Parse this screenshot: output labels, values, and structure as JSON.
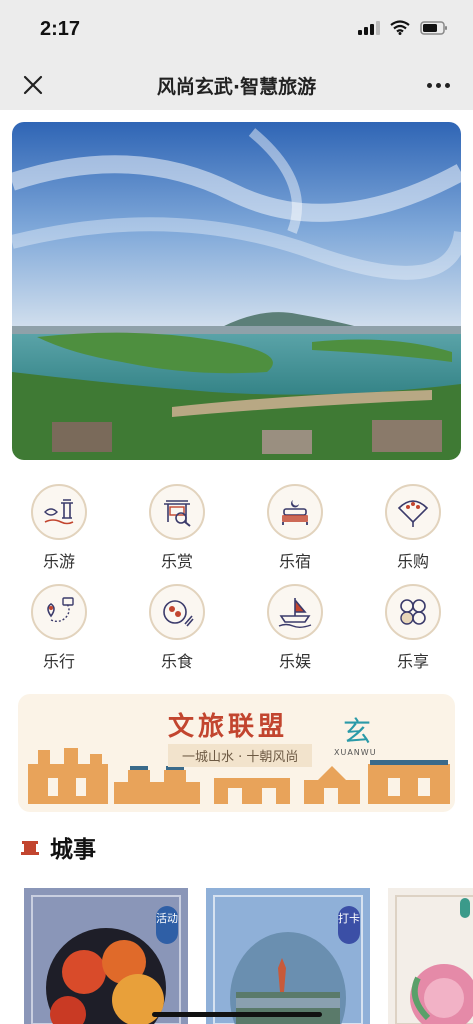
{
  "status_bar": {
    "time": "2:17"
  },
  "nav": {
    "title": "风尚玄武·智慧旅游"
  },
  "categories": [
    {
      "label": "乐游",
      "icon": "pavilion-icon"
    },
    {
      "label": "乐赏",
      "icon": "gate-icon"
    },
    {
      "label": "乐宿",
      "icon": "bed-icon"
    },
    {
      "label": "乐购",
      "icon": "fan-icon"
    },
    {
      "label": "乐行",
      "icon": "route-icon"
    },
    {
      "label": "乐食",
      "icon": "dish-icon"
    },
    {
      "label": "乐娱",
      "icon": "boat-icon"
    },
    {
      "label": "乐享",
      "icon": "clover-icon"
    }
  ],
  "alliance": {
    "title": "文旅联盟",
    "subtitle": "一城山水 · 十朝风尚",
    "logo_glyph": "玄",
    "logo_text": "XUANWU"
  },
  "section": {
    "title": "城事"
  },
  "cards": [
    {
      "badge": "活动"
    },
    {
      "badge": "打卡"
    },
    {
      "badge": ""
    }
  ],
  "colors": {
    "accent": "#c2452f",
    "ring": "#e2d3bd",
    "icon_dark": "#3b3b6b",
    "teal": "#2a9aa8"
  }
}
